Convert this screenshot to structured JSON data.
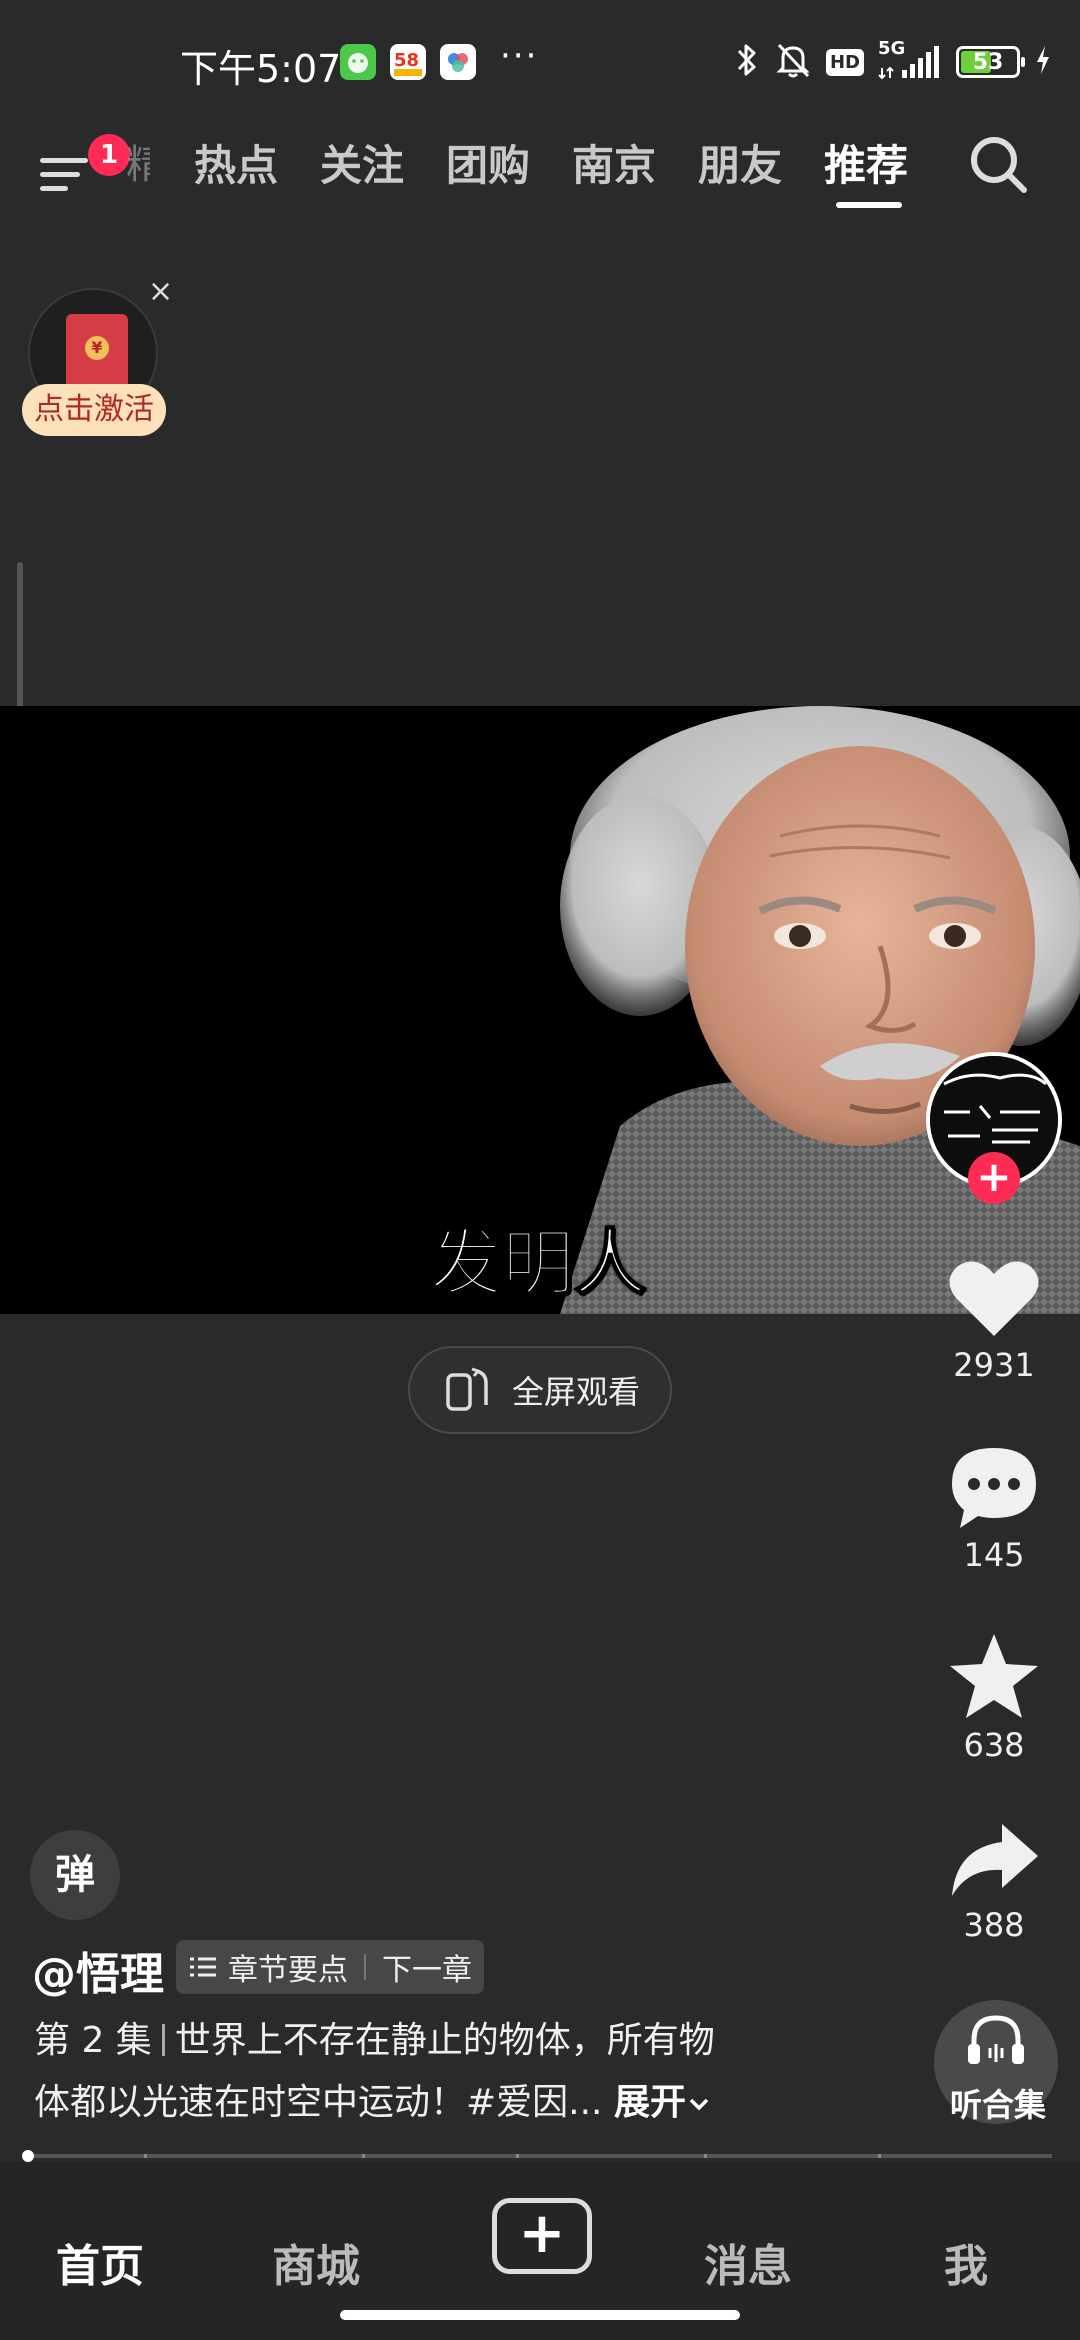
{
  "status_bar": {
    "time": "下午5:07",
    "more_dots": "···",
    "battery_level": "53",
    "network_label": "5G",
    "hd_label": "HD",
    "app_icons": [
      "wechat-like-icon",
      "58-app-icon",
      "cloud-app-icon"
    ]
  },
  "top_nav": {
    "badge_count": "1",
    "partial_tab": "精选",
    "tabs": [
      "热点",
      "关注",
      "团购",
      "南京",
      "朋友",
      "推荐"
    ],
    "active_tab": "推荐"
  },
  "promo": {
    "label": "点击激活",
    "close": "×"
  },
  "video": {
    "subtitle": "发明人",
    "fullscreen_label": "全屏观看"
  },
  "actions": {
    "likes": "2931",
    "comments": "145",
    "favorites": "638",
    "shares": "388",
    "follow": "+"
  },
  "post": {
    "danmu_label": "弹",
    "author": "@悟理",
    "chapter_points": "章节要点",
    "next_chapter": "下一章",
    "episode": "第 2 集",
    "description_line1": "世界上不存在静止的物体，所有物",
    "description_line2": "体都以光速在时空中运动！#爱因...",
    "expand": "展开",
    "listen_label": "听合集",
    "progress_fraction": 0.0
  },
  "tab_bar": {
    "home": "首页",
    "mall": "商城",
    "add": "+",
    "messages": "消息",
    "me": "我"
  },
  "colors": {
    "background": "#2a2a2a",
    "accent_red": "#fe2c55",
    "promo_bg": "#fde1bd",
    "battery_green": "#6fcf3a"
  }
}
